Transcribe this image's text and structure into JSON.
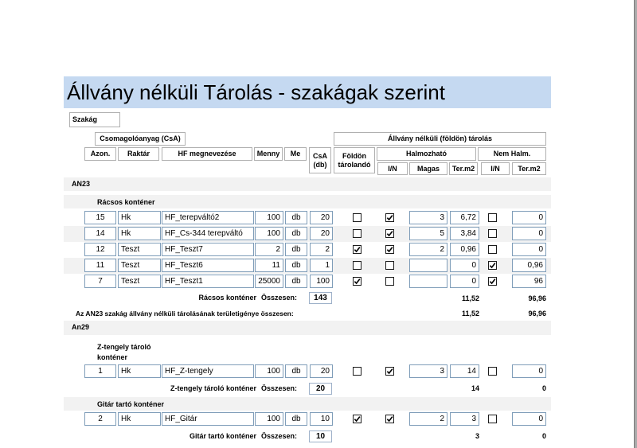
{
  "report_title": "Állvány nélküli Tárolás - szakágak szerint",
  "header": {
    "szakag_label": "Szakág",
    "csa_group": "Csomagolóanyag (CsA)",
    "allvany_group": "Állvány nélküli (földön) tárolás",
    "azon": "Azon.",
    "raktar": "Raktár",
    "hf_megnevezese": "HF megnevezése",
    "menny": "Menny",
    "me": "Me",
    "csa_db_line1": "CsA",
    "csa_db_line2": "(db)",
    "foldon_line1": "Földön",
    "foldon_line2": "tárolandó",
    "halmozhato": "Halmozható",
    "nem_halm": "Nem Halm.",
    "in1": "I/N",
    "magas": "Magas",
    "ter_m2_1": "Ter.m2",
    "in2": "I/N",
    "ter_m2_2": "Ter.m2"
  },
  "groups": [
    {
      "name": "AN23",
      "subgroups": [
        {
          "name": "Rácsos konténer",
          "rows": [
            {
              "azon": "15",
              "raktar": "Hk",
              "hf": "HF_terepváltó2",
              "menny": "100",
              "me": "db",
              "csa": "20",
              "foldon": false,
              "halm": true,
              "magas": "3",
              "ter1": "6,72",
              "nem": false,
              "ter2": "0"
            },
            {
              "azon": "14",
              "raktar": "Hk",
              "hf": "HF_Cs-344 terepváltó",
              "menny": "100",
              "me": "db",
              "csa": "20",
              "foldon": false,
              "halm": true,
              "magas": "5",
              "ter1": "3,84",
              "nem": false,
              "ter2": "0"
            },
            {
              "azon": "12",
              "raktar": "Teszt",
              "hf": "HF_Teszt7",
              "menny": "2",
              "me": "db",
              "csa": "2",
              "foldon": true,
              "halm": true,
              "magas": "2",
              "ter1": "0,96",
              "nem": false,
              "ter2": "0"
            },
            {
              "azon": "11",
              "raktar": "Teszt",
              "hf": "HF_Teszt6",
              "menny": "11",
              "me": "db",
              "csa": "1",
              "foldon": false,
              "halm": false,
              "magas": "",
              "ter1": "0",
              "nem": true,
              "ter2": "0,96"
            },
            {
              "azon": "7",
              "raktar": "Teszt",
              "hf": "HF_Teszt1",
              "menny": "25000",
              "me": "db",
              "csa": "100",
              "foldon": true,
              "halm": false,
              "magas": "",
              "ter1": "0",
              "nem": true,
              "ter2": "96"
            }
          ],
          "footer_label": "Rácsos konténer",
          "osszesen_label": "Összesen:",
          "total": "143",
          "ter1_sum": "11,52",
          "ter2_sum": "96,96"
        }
      ],
      "group_total_label": "Az AN23 szakág állvány nélküli tárolásának területigénye összesen:",
      "group_ter1": "11,52",
      "group_ter2": "96,96"
    },
    {
      "name": "An29",
      "subgroups": [
        {
          "name_line1": "Z-tengely tároló",
          "name_line2": "konténer",
          "rows": [
            {
              "azon": "1",
              "raktar": "Hk",
              "hf": "HF_Z-tengely",
              "menny": "100",
              "me": "db",
              "csa": "20",
              "foldon": false,
              "halm": true,
              "magas": "3",
              "ter1": "14",
              "nem": false,
              "ter2": "0"
            }
          ],
          "footer_label": "Z-tengely tároló konténer",
          "osszesen_label": "Összesen:",
          "total": "20",
          "ter1_sum": "14",
          "ter2_sum": "0"
        },
        {
          "name": "Gitár tartó konténer",
          "rows": [
            {
              "azon": "2",
              "raktar": "Hk",
              "hf": "HF_Gitár",
              "menny": "100",
              "me": "db",
              "csa": "10",
              "foldon": true,
              "halm": true,
              "magas": "2",
              "ter1": "3",
              "nem": false,
              "ter2": "0"
            }
          ],
          "footer_label": "Gitár tartó konténer",
          "osszesen_label": "Összesen:",
          "total": "10",
          "ter1_sum": "3",
          "ter2_sum": "0"
        }
      ]
    }
  ]
}
